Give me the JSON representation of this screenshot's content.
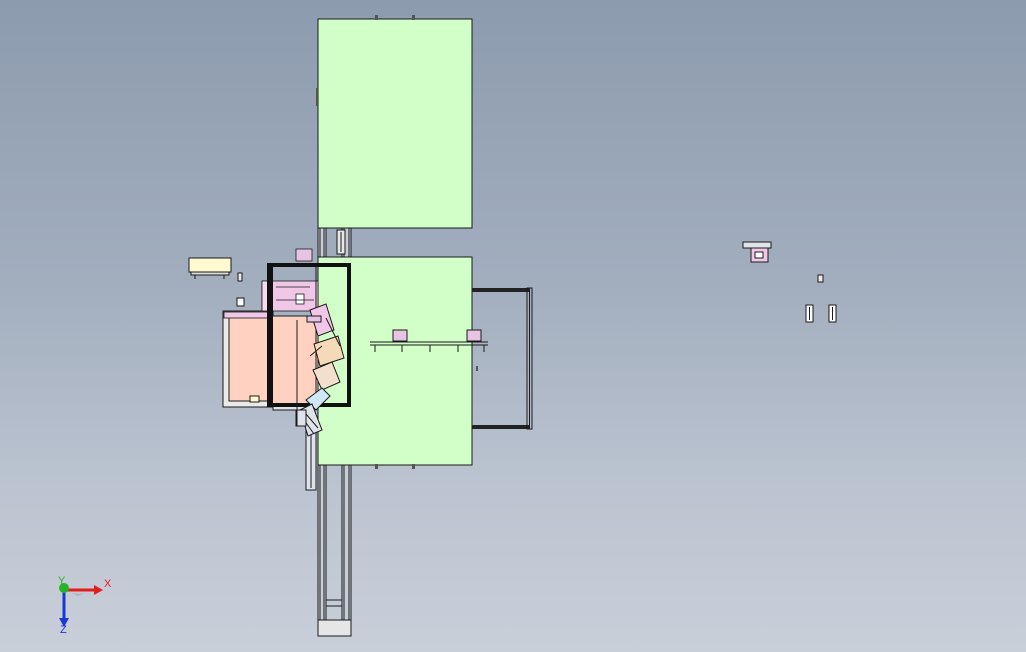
{
  "triad": {
    "x_label": "X",
    "y_label": "Y",
    "z_label": "Z"
  },
  "colors": {
    "panel_green": "#d2ffc8",
    "salmon": "#ffd1c1",
    "pink": "#f1c7e8",
    "beige": "#fffad0",
    "light_blue": "#cfe7f7",
    "outline": "#1a1a1a",
    "axis_x": "#e21d1d",
    "axis_y": "#23b527",
    "axis_z": "#1a37d6"
  }
}
